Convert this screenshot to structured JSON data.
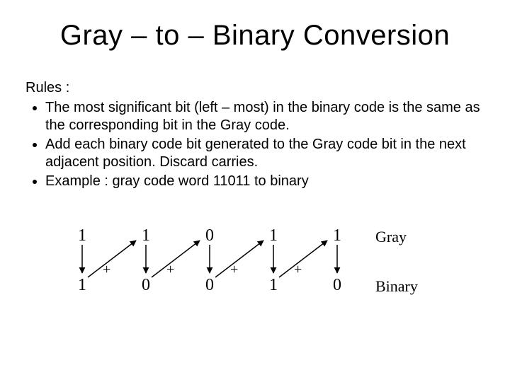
{
  "title": "Gray – to – Binary Conversion",
  "rules_label": "Rules :",
  "rules": [
    "The most significant bit (left – most) in the binary code is the same as the corresponding bit in the Gray code.",
    "Add each binary code bit generated to the Gray code bit in the next adjacent position. Discard carries.",
    "Example : gray code word 11011 to binary"
  ],
  "diagram": {
    "gray_label": "Gray",
    "binary_label": "Binary",
    "gray_bits": [
      "1",
      "1",
      "0",
      "1",
      "1"
    ],
    "binary_bits": [
      "1",
      "0",
      "0",
      "1",
      "0"
    ],
    "plus": "+"
  }
}
